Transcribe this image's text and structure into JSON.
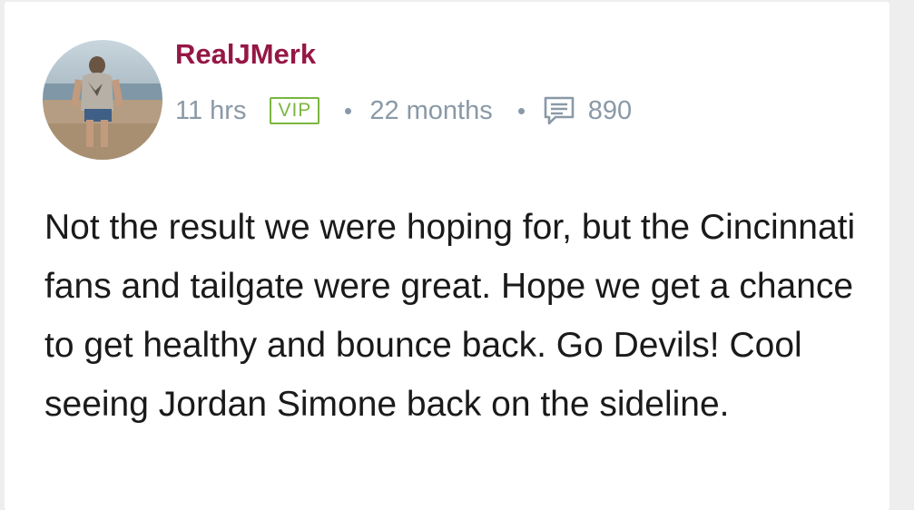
{
  "post": {
    "author": "RealJMerk",
    "time_ago": "11 hrs",
    "badge": "VIP",
    "membership": "22 months",
    "post_count": "890",
    "text": "Not the result we were hoping for, but the Cincinnati fans and tailgate were great. Hope we get a chance to get healthy and bounce back. Go Devils! Cool seeing Jordan Simone back on the sideline."
  },
  "icons": {
    "avatar": "user-avatar-photo",
    "posts": "message-count-icon"
  },
  "colors": {
    "author": "#951745",
    "meta": "#8a99a7",
    "badge": "#7ab63f",
    "body_text": "#1a1a1a"
  }
}
